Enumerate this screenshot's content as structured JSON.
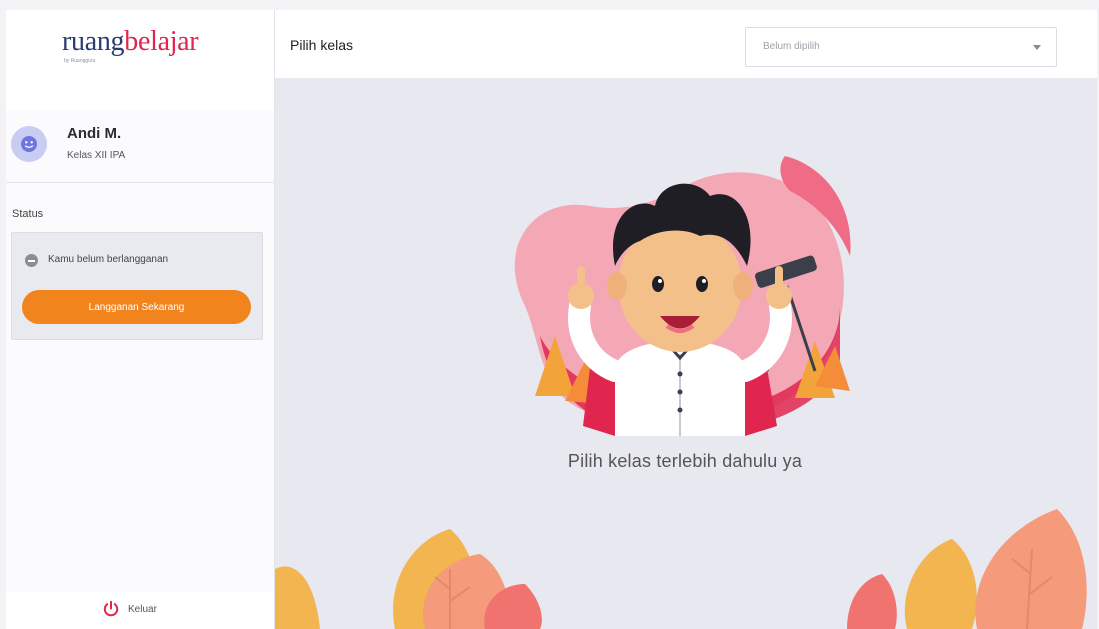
{
  "brand": {
    "name_part1": "ruang",
    "name_part2": "belajar",
    "tagline": "by Ruangguru",
    "colors": {
      "navy": "#2d3c6e",
      "red": "#e0264f"
    }
  },
  "user": {
    "name": "Andi M.",
    "class": "Kelas XII IPA",
    "avatar_icon": "smiley-face-icon"
  },
  "status": {
    "label": "Status",
    "message": "Kamu belum berlangganan",
    "button_label": "Langganan Sekarang",
    "button_color": "#f2841e"
  },
  "logout": {
    "label": "Keluar",
    "icon": "power-icon",
    "icon_color": "#e0264f"
  },
  "header": {
    "title": "Pilih kelas",
    "select": {
      "selected": "Belum dipilih"
    }
  },
  "main": {
    "empty_message": "Pilih kelas terlebih dahulu ya"
  }
}
